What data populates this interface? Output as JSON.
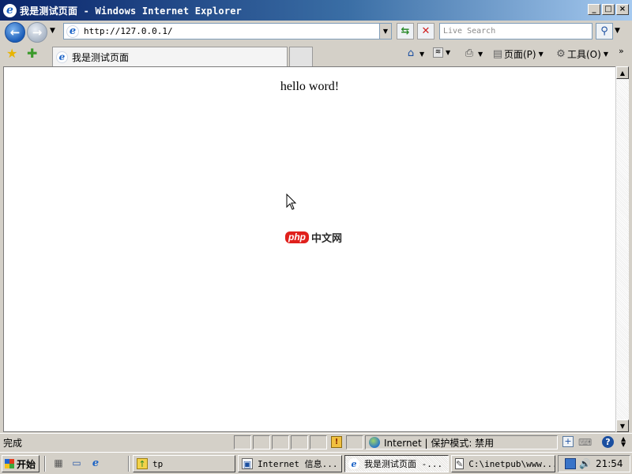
{
  "window": {
    "title": "我是测试页面 - Windows Internet Explorer",
    "buttons": {
      "minimize": "_",
      "maximize": "□",
      "close": "×"
    }
  },
  "address_bar": {
    "url": "http://127.0.0.1/",
    "search_placeholder": "Live Search"
  },
  "tab": {
    "label": "我是测试页面"
  },
  "commands": {
    "page_label": "页面(P)",
    "tools_label": "工具(O)"
  },
  "content": {
    "heading": "hello word!",
    "watermark_badge": "php",
    "watermark_text": "中文网"
  },
  "status_bar": {
    "status_text": "完成",
    "zone_text": "Internet | 保护模式: 禁用"
  },
  "taskbar": {
    "start_label": "开始",
    "tasks": [
      {
        "label": "tp",
        "icon": "folder-icon",
        "active": false
      },
      {
        "label": "Internet 信息...",
        "icon": "iis-manager-icon",
        "active": false
      },
      {
        "label": "我是测试页面 -...",
        "icon": "ie-icon",
        "active": true
      },
      {
        "label": "C:\\inetpub\\www...",
        "icon": "notepad-icon",
        "active": false
      }
    ],
    "clock": "21:54"
  },
  "colors": {
    "titlebar_start": "#0a246a",
    "titlebar_end": "#a6caf0",
    "chrome": "#d4d0c8",
    "watermark_red": "#e0201c"
  }
}
